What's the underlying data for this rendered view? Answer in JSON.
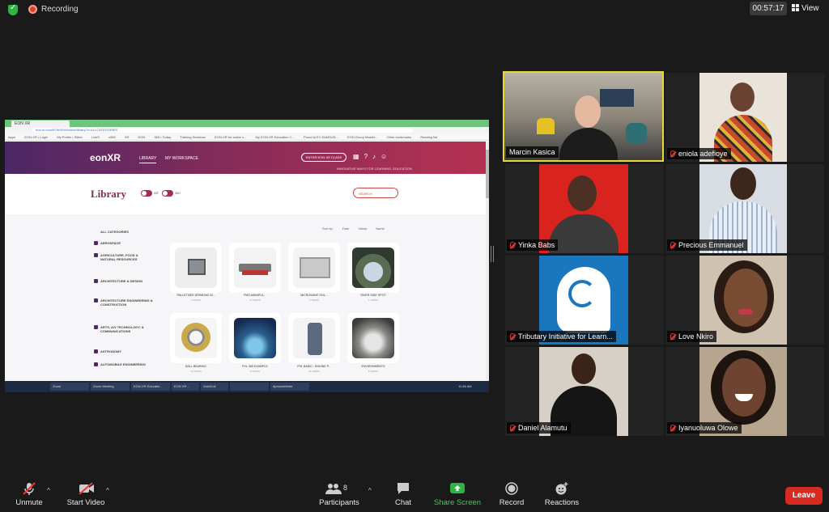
{
  "top": {
    "recording_label": "Recording",
    "timer": "00:57:17",
    "view_label": "View"
  },
  "share": {
    "tab_label": "EON XR",
    "url": "eon-xr.com/EONXR/#/eonxr/library?c=ALLCATEGORIES",
    "bookmarks": [
      "Apps",
      "EON-XR • Login",
      "My Profile • Stitch",
      "LinkS",
      "x365",
      "XR",
      "EON",
      "365 • Today",
      "Training Sessions",
      "EON-XR for active s...",
      "My EON-XR Education C...",
      "Proud to EY-SAMSUN...",
      "EON Group Master...",
      "Other bookmarks",
      "Reading list"
    ],
    "eon": {
      "logo": "eonXR",
      "nav_library": "LIBRARY",
      "nav_workspace": "MY WORKSPACE",
      "enter_button": "ENTER EON XR CLASS",
      "tagline": "INNOVATIVE WAYS FOR LEARNING, EDUCATION",
      "library_title": "Library",
      "toggle1_label": "AR",
      "toggle2_label": "360",
      "search_placeholder": "SEARCH",
      "sort_by": "Sort by:",
      "sort_date": "Date",
      "sort_views": "Views",
      "sort_name": "Name",
      "categories": [
        "ALL CATEGORIES",
        "AEROSPACE",
        "AGRICULTURE, FOOD & NATURAL RESOURCES",
        "ARCHITECTURE & DESIGN",
        "ARCHITECTURE ENGINEERING & CONSTRUCTION",
        "ARTS, A/V TECHNOLOGY, & COMMUNICATIONS",
        "ASTRONOMY",
        "AUTOMOBILE ENGINEERING"
      ],
      "cards": [
        {
          "title": "PALLETIZED DRINKING W...",
          "views": "2 VIEWS"
        },
        {
          "title": "FMS-MANIPUL...",
          "views": "17 VIEWS"
        },
        {
          "title": "MICROWAVE ONL...",
          "views": "2 VIEWS"
        },
        {
          "title": "RIVER SIDE SPOT",
          "views": "1 VIEWS"
        },
        {
          "title": "BALL BEARING",
          "views": "11 VIEWS"
        },
        {
          "title": "FHL 360 EXAMPLE",
          "views": "9 VIEWS"
        },
        {
          "title": "FHL BASIC - ENGINE P...",
          "views": "11 VIEWS"
        },
        {
          "title": "ENVIRONMENTS",
          "views": "8 VIEWS"
        }
      ]
    },
    "taskbar": [
      "Zoom",
      "Zoom Meeting",
      "EON-XR Educatio...",
      "EON XR - Google...",
      "GoldCoil",
      "",
      "dpmoveMeter"
    ],
    "clock": "11:46 AM"
  },
  "participants": [
    {
      "name": "Marcin Kasica",
      "muted": false,
      "active": true
    },
    {
      "name": "eniola adefioye",
      "muted": true
    },
    {
      "name": "Yinka Babs",
      "muted": true
    },
    {
      "name": "Precious Emmanuel",
      "muted": true
    },
    {
      "name": "Tributary Initiative for Learn...",
      "muted": true
    },
    {
      "name": "Love Nkiro",
      "muted": true
    },
    {
      "name": "Daniel Alamutu",
      "muted": true
    },
    {
      "name": "Iyanuoluwa Olowe",
      "muted": true
    }
  ],
  "toolbar": {
    "unmute": "Unmute",
    "start_video": "Start Video",
    "participants": "Participants",
    "participants_count": "8",
    "chat": "Chat",
    "share_screen": "Share Screen",
    "record": "Record",
    "reactions": "Reactions",
    "leave": "Leave"
  },
  "colors": {
    "share_screen_green": "#2fb344",
    "leave_red": "#d72a21",
    "active_speaker_border": "#e8d92f",
    "eon_brand": "#8a2c58"
  }
}
